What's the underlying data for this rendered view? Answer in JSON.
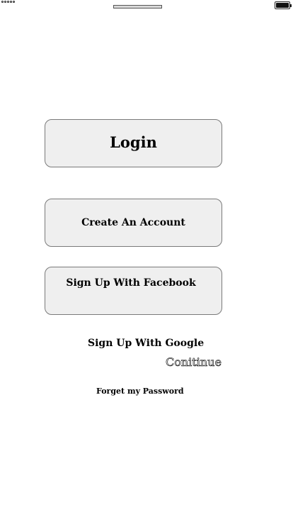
{
  "status_bar": {
    "signal_icon": "signal-dots-icon",
    "battery_icon": "battery-icon",
    "battery_level": 1.0
  },
  "auth": {
    "login_label": "Login",
    "create_account_label": "Create An Account",
    "facebook_label": "Sign Up With Facebook",
    "google_label": "Sign Up With Google",
    "continue_label": "Conitinue",
    "forgot_password_label": "Forget my Password"
  },
  "colors": {
    "button_background": "#efefef",
    "button_border": "#7a7a7a",
    "page_background": "#ffffff"
  }
}
